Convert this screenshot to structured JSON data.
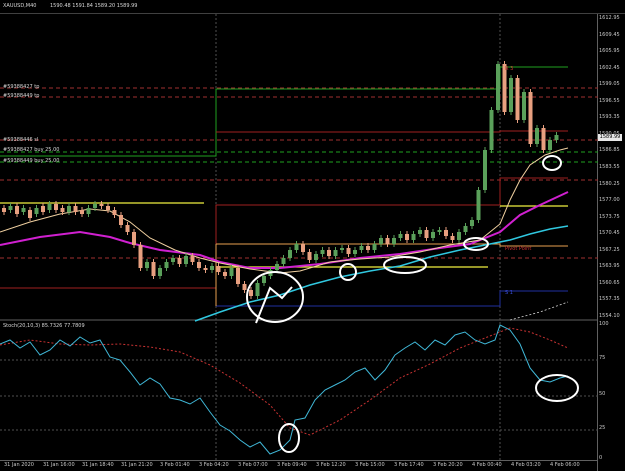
{
  "window": {
    "title": "XAUUSD,M40",
    "ohlc": "1590.48  1591.84  1589.20  1589.99"
  },
  "order_tags": [
    {
      "label": "#59388427 tp"
    },
    {
      "label": "#59388449 tp"
    },
    {
      "label": "#59388446 sl"
    },
    {
      "label": "#59388427 buy 25.00"
    },
    {
      "label": "#59388449 buy 25.00"
    }
  ],
  "price_axis": {
    "labels": [
      "1612.95",
      "1609.45",
      "1605.95",
      "1602.45",
      "1599.05",
      "1596.55",
      "1593.35",
      "1590.05",
      "1586.85",
      "1583.55",
      "1580.25",
      "1577.00",
      "1573.75",
      "1570.45",
      "1567.25",
      "1563.95",
      "1560.65",
      "1557.35",
      "1554.10"
    ],
    "current_price": "1589.99",
    "current_color": "#e8e8e8"
  },
  "pivot_labels": {
    "r": "R 3",
    "pivot": "Pivot Point",
    "s": "S 1",
    "r_color": "#c83232",
    "s_color": "#3c50dc"
  },
  "stoch": {
    "label": "Stoch(20,10,3) 85.7326 77.7809",
    "axis_labels": [
      "100",
      "75",
      "50",
      "25",
      "0"
    ],
    "main_color": "#40b8d8",
    "signal_color": "#c83232"
  },
  "time_axis": {
    "labels": [
      "31 Jan 2020",
      "31 Jan 16:00",
      "31 Jan 18:40",
      "31 Jan 21:20",
      "3 Feb 01:40",
      "3 Feb 04:20",
      "3 Feb 07:00",
      "3 Feb 09:40",
      "3 Feb 12:20",
      "3 Feb 15:00",
      "3 Feb 17:40",
      "3 Feb 20:20",
      "4 Feb 00:40",
      "4 Feb 03:20",
      "4 Feb 06:00"
    ]
  },
  "colors": {
    "bull_candle": "#5aa05a",
    "bear_candle": "#e8a080",
    "ma_slow": "#d020d0",
    "ma_fast": "#f0d0a0",
    "ma_cyan": "#30c8e0",
    "yellow_level": "#f0f040",
    "orange_level": "#e8a050",
    "green_line": "#20a020"
  }
}
